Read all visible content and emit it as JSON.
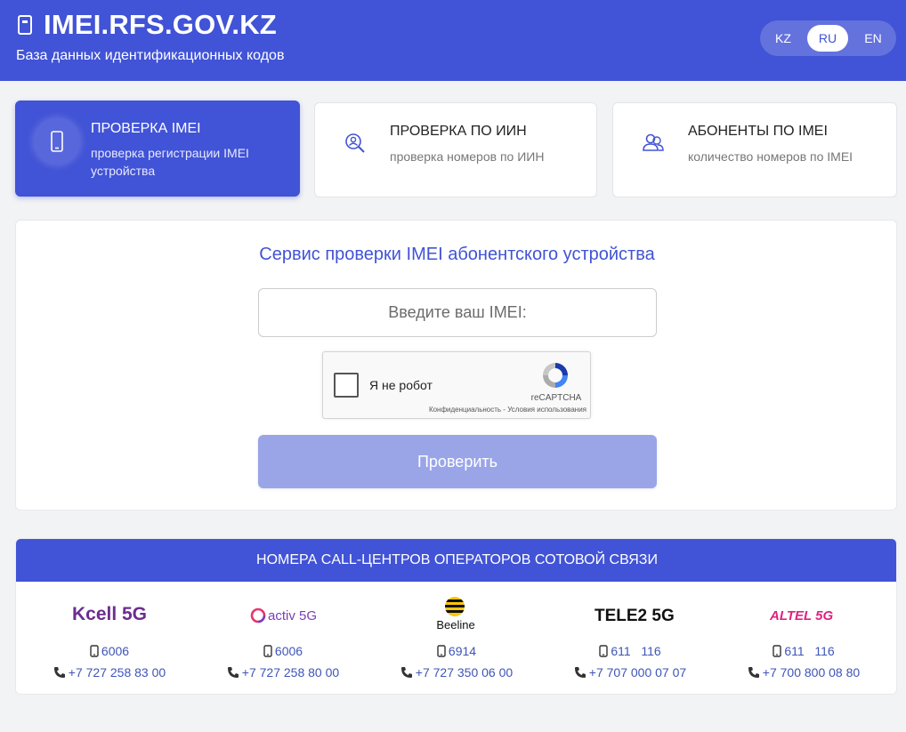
{
  "header": {
    "title": "IMEI.RFS.GOV.KZ",
    "subtitle": "База данных идентификационных кодов",
    "languages": [
      "KZ",
      "RU",
      "EN"
    ],
    "active_language": "RU"
  },
  "cards": [
    {
      "title": "ПРОВЕРКА IMEI",
      "subtitle": "проверка регистрации IMEI устройства",
      "active": true
    },
    {
      "title": "ПРОВЕРКА ПО ИИН",
      "subtitle": "проверка номеров по ИИН",
      "active": false
    },
    {
      "title": "АБОНЕНТЫ ПО IMEI",
      "subtitle": "количество номеров по IMEI",
      "active": false
    }
  ],
  "form": {
    "title": "Сервис проверки IMEI абонентского устройства",
    "placeholder": "Введите ваш IMEI:",
    "captcha_label": "Я не робот",
    "captcha_brand": "reCAPTCHA",
    "captcha_links": "Конфиденциальность - Условия использования",
    "submit_label": "Проверить"
  },
  "call_centers": {
    "title": "НОМЕРА CALL-ЦЕНТРОВ ОПЕРАТОРОВ СОТОВОЙ СВЯЗИ",
    "operators": [
      {
        "name": "Kcell 5G",
        "short": "6006",
        "phone": "+7 727 258 83 00"
      },
      {
        "name": "activ 5G",
        "short": "6006",
        "phone": "+7 727 258 80 00"
      },
      {
        "name": "Beeline",
        "short": "6914",
        "phone": "+7 727 350 06 00"
      },
      {
        "name": "TELE2 5G",
        "short": "611   116",
        "phone": "+7 707 000 07 07"
      },
      {
        "name": "ALTEL 5G",
        "short": "611   116",
        "phone": "+7 700 800 08 80"
      }
    ]
  },
  "colors": {
    "brand": "#4153d6",
    "button_disabled": "#9aa5e8",
    "link": "#3e55b8"
  }
}
